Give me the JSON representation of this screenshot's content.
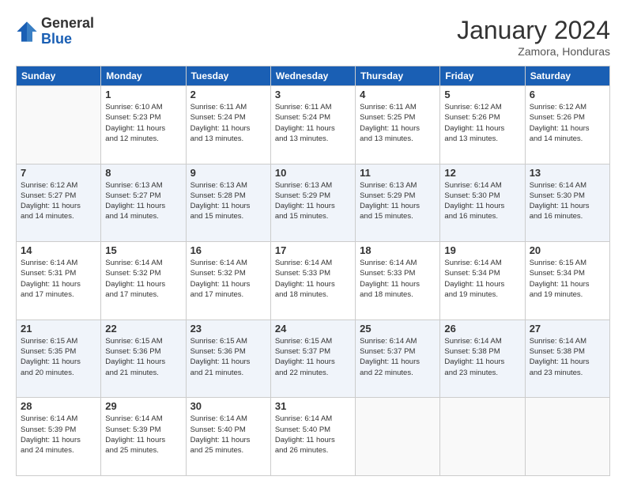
{
  "header": {
    "logo": {
      "general": "General",
      "blue": "Blue"
    },
    "title": "January 2024",
    "subtitle": "Zamora, Honduras"
  },
  "weekdays": [
    "Sunday",
    "Monday",
    "Tuesday",
    "Wednesday",
    "Thursday",
    "Friday",
    "Saturday"
  ],
  "weeks": [
    [
      {
        "day": "",
        "info": ""
      },
      {
        "day": "1",
        "info": "Sunrise: 6:10 AM\nSunset: 5:23 PM\nDaylight: 11 hours\nand 12 minutes."
      },
      {
        "day": "2",
        "info": "Sunrise: 6:11 AM\nSunset: 5:24 PM\nDaylight: 11 hours\nand 13 minutes."
      },
      {
        "day": "3",
        "info": "Sunrise: 6:11 AM\nSunset: 5:24 PM\nDaylight: 11 hours\nand 13 minutes."
      },
      {
        "day": "4",
        "info": "Sunrise: 6:11 AM\nSunset: 5:25 PM\nDaylight: 11 hours\nand 13 minutes."
      },
      {
        "day": "5",
        "info": "Sunrise: 6:12 AM\nSunset: 5:26 PM\nDaylight: 11 hours\nand 13 minutes."
      },
      {
        "day": "6",
        "info": "Sunrise: 6:12 AM\nSunset: 5:26 PM\nDaylight: 11 hours\nand 14 minutes."
      }
    ],
    [
      {
        "day": "7",
        "info": "Sunrise: 6:12 AM\nSunset: 5:27 PM\nDaylight: 11 hours\nand 14 minutes."
      },
      {
        "day": "8",
        "info": "Sunrise: 6:13 AM\nSunset: 5:27 PM\nDaylight: 11 hours\nand 14 minutes."
      },
      {
        "day": "9",
        "info": "Sunrise: 6:13 AM\nSunset: 5:28 PM\nDaylight: 11 hours\nand 15 minutes."
      },
      {
        "day": "10",
        "info": "Sunrise: 6:13 AM\nSunset: 5:29 PM\nDaylight: 11 hours\nand 15 minutes."
      },
      {
        "day": "11",
        "info": "Sunrise: 6:13 AM\nSunset: 5:29 PM\nDaylight: 11 hours\nand 15 minutes."
      },
      {
        "day": "12",
        "info": "Sunrise: 6:14 AM\nSunset: 5:30 PM\nDaylight: 11 hours\nand 16 minutes."
      },
      {
        "day": "13",
        "info": "Sunrise: 6:14 AM\nSunset: 5:30 PM\nDaylight: 11 hours\nand 16 minutes."
      }
    ],
    [
      {
        "day": "14",
        "info": "Sunrise: 6:14 AM\nSunset: 5:31 PM\nDaylight: 11 hours\nand 17 minutes."
      },
      {
        "day": "15",
        "info": "Sunrise: 6:14 AM\nSunset: 5:32 PM\nDaylight: 11 hours\nand 17 minutes."
      },
      {
        "day": "16",
        "info": "Sunrise: 6:14 AM\nSunset: 5:32 PM\nDaylight: 11 hours\nand 17 minutes."
      },
      {
        "day": "17",
        "info": "Sunrise: 6:14 AM\nSunset: 5:33 PM\nDaylight: 11 hours\nand 18 minutes."
      },
      {
        "day": "18",
        "info": "Sunrise: 6:14 AM\nSunset: 5:33 PM\nDaylight: 11 hours\nand 18 minutes."
      },
      {
        "day": "19",
        "info": "Sunrise: 6:14 AM\nSunset: 5:34 PM\nDaylight: 11 hours\nand 19 minutes."
      },
      {
        "day": "20",
        "info": "Sunrise: 6:15 AM\nSunset: 5:34 PM\nDaylight: 11 hours\nand 19 minutes."
      }
    ],
    [
      {
        "day": "21",
        "info": "Sunrise: 6:15 AM\nSunset: 5:35 PM\nDaylight: 11 hours\nand 20 minutes."
      },
      {
        "day": "22",
        "info": "Sunrise: 6:15 AM\nSunset: 5:36 PM\nDaylight: 11 hours\nand 21 minutes."
      },
      {
        "day": "23",
        "info": "Sunrise: 6:15 AM\nSunset: 5:36 PM\nDaylight: 11 hours\nand 21 minutes."
      },
      {
        "day": "24",
        "info": "Sunrise: 6:15 AM\nSunset: 5:37 PM\nDaylight: 11 hours\nand 22 minutes."
      },
      {
        "day": "25",
        "info": "Sunrise: 6:14 AM\nSunset: 5:37 PM\nDaylight: 11 hours\nand 22 minutes."
      },
      {
        "day": "26",
        "info": "Sunrise: 6:14 AM\nSunset: 5:38 PM\nDaylight: 11 hours\nand 23 minutes."
      },
      {
        "day": "27",
        "info": "Sunrise: 6:14 AM\nSunset: 5:38 PM\nDaylight: 11 hours\nand 23 minutes."
      }
    ],
    [
      {
        "day": "28",
        "info": "Sunrise: 6:14 AM\nSunset: 5:39 PM\nDaylight: 11 hours\nand 24 minutes."
      },
      {
        "day": "29",
        "info": "Sunrise: 6:14 AM\nSunset: 5:39 PM\nDaylight: 11 hours\nand 25 minutes."
      },
      {
        "day": "30",
        "info": "Sunrise: 6:14 AM\nSunset: 5:40 PM\nDaylight: 11 hours\nand 25 minutes."
      },
      {
        "day": "31",
        "info": "Sunrise: 6:14 AM\nSunset: 5:40 PM\nDaylight: 11 hours\nand 26 minutes."
      },
      {
        "day": "",
        "info": ""
      },
      {
        "day": "",
        "info": ""
      },
      {
        "day": "",
        "info": ""
      }
    ]
  ]
}
